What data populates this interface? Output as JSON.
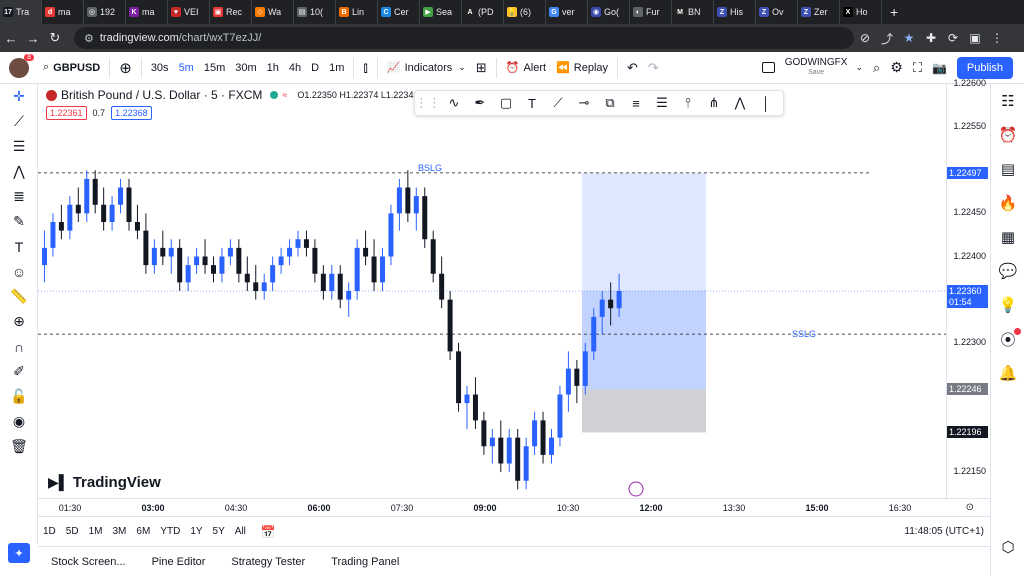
{
  "browser": {
    "tabs": [
      {
        "label": "Tra",
        "color": "#131722",
        "glyph": "17"
      },
      {
        "label": "ma",
        "color": "#e53935",
        "glyph": "d"
      },
      {
        "label": "192",
        "color": "#5f6368",
        "glyph": "◎"
      },
      {
        "label": "ma",
        "color": "#7b1fa2",
        "glyph": "K"
      },
      {
        "label": "VEI",
        "color": "#c62828",
        "glyph": "♥"
      },
      {
        "label": "Rec",
        "color": "#e53935",
        "glyph": "▣"
      },
      {
        "label": "Wa",
        "color": "#f57c00",
        "glyph": "◇"
      },
      {
        "label": "10(",
        "color": "#5f6368",
        "glyph": "▤"
      },
      {
        "label": "Lin",
        "color": "#ef6c00",
        "glyph": "B"
      },
      {
        "label": "Cer",
        "color": "#1e88e5",
        "glyph": "C"
      },
      {
        "label": "Sea",
        "color": "#43a047",
        "glyph": "▶"
      },
      {
        "label": "(PD",
        "color": "#212121",
        "glyph": "A"
      },
      {
        "label": "(6)",
        "color": "#fbc02d",
        "glyph": "💡"
      },
      {
        "label": "ver",
        "color": "#4285f4",
        "glyph": "G"
      },
      {
        "label": "Go(",
        "color": "#3949ab",
        "glyph": "◉"
      },
      {
        "label": "Fur",
        "color": "#5f6368",
        "glyph": "◐"
      },
      {
        "label": "BN",
        "color": "#212121",
        "glyph": "M"
      },
      {
        "label": "His",
        "color": "#3f51b5",
        "glyph": "Z"
      },
      {
        "label": "Ov",
        "color": "#3f51b5",
        "glyph": "Z"
      },
      {
        "label": "Zer",
        "color": "#3f51b5",
        "glyph": "Z"
      },
      {
        "label": "Ho",
        "color": "#000000",
        "glyph": "X"
      }
    ],
    "new_tab": "+",
    "url_host": "tradingview.com",
    "url_path": "/chart/wxT7ezJJ/"
  },
  "toolbar": {
    "symbol": "GBPUSD",
    "intervals": [
      "30s",
      "5m",
      "15m",
      "30m",
      "1h",
      "4h",
      "D",
      "1m"
    ],
    "active_interval": "5m",
    "indicators": "Indicators",
    "alert": "Alert",
    "replay": "Replay",
    "layout_name": "GODWINGFX",
    "layout_status": "Save",
    "publish": "Publish",
    "notification_count": "8"
  },
  "legend": {
    "title": "British Pound / U.S. Dollar · 5 · FXCM",
    "ohlc": "O1.22350 H1.22374 L1.2234",
    "sell_price": "1.22361",
    "spread": "0.7",
    "buy_price": "1.22368"
  },
  "annotations": {
    "bslg": "BSLG",
    "sslg": "SSLG"
  },
  "price_axis": {
    "labels": [
      "1.22600",
      "1.22550",
      "1.22450",
      "1.22400",
      "1.22300",
      "1.22150"
    ],
    "tags": [
      {
        "value": "1.22497",
        "color": "#2962ff"
      },
      {
        "value": "1.22360",
        "sub": "01:54",
        "color": "#2962ff"
      },
      {
        "value": "1.22246",
        "color": "#787b86"
      },
      {
        "value": "1.22196",
        "color": "#131722"
      }
    ]
  },
  "time_axis": {
    "labels": [
      "01:30",
      "03:00",
      "04:30",
      "06:00",
      "07:30",
      "09:00",
      "10:30",
      "12:00",
      "13:30",
      "15:00",
      "16:30"
    ],
    "bold": [
      "03:00",
      "06:00",
      "09:00",
      "12:00",
      "15:00"
    ]
  },
  "ranges": [
    "1D",
    "5D",
    "1M",
    "3M",
    "6M",
    "YTD",
    "1Y",
    "5Y",
    "All"
  ],
  "clock": "11:48:05 (UTC+1)",
  "bottom_tabs": [
    "Stock Screen...",
    "Pine Editor",
    "Strategy Tester",
    "Trading Panel"
  ],
  "logo_text": "TradingView",
  "chart_data": {
    "type": "candlestick",
    "ylim": [
      1.2212,
      1.226
    ],
    "candles": [
      [
        1.2239,
        1.2243,
        1.2237,
        1.2241
      ],
      [
        1.2241,
        1.2245,
        1.224,
        1.2244
      ],
      [
        1.2244,
        1.2246,
        1.2242,
        1.2243
      ],
      [
        1.2243,
        1.2247,
        1.2242,
        1.2246
      ],
      [
        1.2246,
        1.2248,
        1.2244,
        1.2245
      ],
      [
        1.2245,
        1.225,
        1.2244,
        1.2249
      ],
      [
        1.2249,
        1.225,
        1.2245,
        1.2246
      ],
      [
        1.2246,
        1.2248,
        1.2243,
        1.2244
      ],
      [
        1.2244,
        1.2247,
        1.2243,
        1.2246
      ],
      [
        1.2246,
        1.2249,
        1.2245,
        1.2248
      ],
      [
        1.2248,
        1.2249,
        1.2243,
        1.2244
      ],
      [
        1.2244,
        1.2246,
        1.2242,
        1.2243
      ],
      [
        1.2243,
        1.2245,
        1.2238,
        1.2239
      ],
      [
        1.2239,
        1.2242,
        1.2238,
        1.2241
      ],
      [
        1.2241,
        1.2243,
        1.2239,
        1.224
      ],
      [
        1.224,
        1.2242,
        1.2238,
        1.2241
      ],
      [
        1.2241,
        1.2242,
        1.2236,
        1.2237
      ],
      [
        1.2237,
        1.224,
        1.2236,
        1.2239
      ],
      [
        1.2239,
        1.2241,
        1.2238,
        1.224
      ],
      [
        1.224,
        1.2242,
        1.2238,
        1.2239
      ],
      [
        1.2239,
        1.224,
        1.2237,
        1.2238
      ],
      [
        1.2238,
        1.2241,
        1.2237,
        1.224
      ],
      [
        1.224,
        1.2242,
        1.2239,
        1.2241
      ],
      [
        1.2241,
        1.2242,
        1.2237,
        1.2238
      ],
      [
        1.2238,
        1.224,
        1.2236,
        1.2237
      ],
      [
        1.2237,
        1.2239,
        1.2235,
        1.2236
      ],
      [
        1.2236,
        1.2238,
        1.2235,
        1.2237
      ],
      [
        1.2237,
        1.224,
        1.2236,
        1.2239
      ],
      [
        1.2239,
        1.2241,
        1.2238,
        1.224
      ],
      [
        1.224,
        1.2242,
        1.2239,
        1.2241
      ],
      [
        1.2241,
        1.2243,
        1.224,
        1.2242
      ],
      [
        1.2242,
        1.2243,
        1.224,
        1.2241
      ],
      [
        1.2241,
        1.2242,
        1.2237,
        1.2238
      ],
      [
        1.2238,
        1.2239,
        1.2235,
        1.2236
      ],
      [
        1.2236,
        1.2239,
        1.2235,
        1.2238
      ],
      [
        1.2238,
        1.2239,
        1.2234,
        1.2235
      ],
      [
        1.2235,
        1.2237,
        1.2233,
        1.2236
      ],
      [
        1.2236,
        1.2242,
        1.2235,
        1.2241
      ],
      [
        1.2241,
        1.2243,
        1.2239,
        1.224
      ],
      [
        1.224,
        1.2242,
        1.2236,
        1.2237
      ],
      [
        1.2237,
        1.2241,
        1.2236,
        1.224
      ],
      [
        1.224,
        1.2246,
        1.2239,
        1.2245
      ],
      [
        1.2245,
        1.2249,
        1.2243,
        1.2248
      ],
      [
        1.2248,
        1.225,
        1.2244,
        1.2245
      ],
      [
        1.2245,
        1.2248,
        1.2243,
        1.2247
      ],
      [
        1.2247,
        1.2248,
        1.2241,
        1.2242
      ],
      [
        1.2242,
        1.2243,
        1.2237,
        1.2238
      ],
      [
        1.2238,
        1.224,
        1.2234,
        1.2235
      ],
      [
        1.2235,
        1.2236,
        1.2228,
        1.2229
      ],
      [
        1.2229,
        1.223,
        1.2222,
        1.2223
      ],
      [
        1.2223,
        1.2225,
        1.222,
        1.2224
      ],
      [
        1.2224,
        1.2226,
        1.222,
        1.2221
      ],
      [
        1.2221,
        1.2222,
        1.2217,
        1.2218
      ],
      [
        1.2218,
        1.222,
        1.2216,
        1.2219
      ],
      [
        1.2219,
        1.2221,
        1.2215,
        1.2216
      ],
      [
        1.2216,
        1.222,
        1.2215,
        1.2219
      ],
      [
        1.2219,
        1.222,
        1.2213,
        1.2214
      ],
      [
        1.2214,
        1.2219,
        1.2213,
        1.2218
      ],
      [
        1.2218,
        1.2222,
        1.2217,
        1.2221
      ],
      [
        1.2221,
        1.2222,
        1.2216,
        1.2217
      ],
      [
        1.2217,
        1.222,
        1.2216,
        1.2219
      ],
      [
        1.2219,
        1.2225,
        1.2218,
        1.2224
      ],
      [
        1.2224,
        1.2229,
        1.2222,
        1.2227
      ],
      [
        1.2227,
        1.2228,
        1.2223,
        1.2225
      ],
      [
        1.2225,
        1.223,
        1.2224,
        1.2229
      ],
      [
        1.2229,
        1.2234,
        1.2228,
        1.2233
      ],
      [
        1.2233,
        1.2236,
        1.2231,
        1.2235
      ],
      [
        1.2235,
        1.2237,
        1.2232,
        1.2234
      ],
      [
        1.2234,
        1.2238,
        1.2233,
        1.2236
      ]
    ]
  },
  "colors": {
    "up": "#2962ff",
    "down": "#131722",
    "target_zone": "#2962ff",
    "stop_zone": "#787b86",
    "accent": "#2962ff"
  }
}
